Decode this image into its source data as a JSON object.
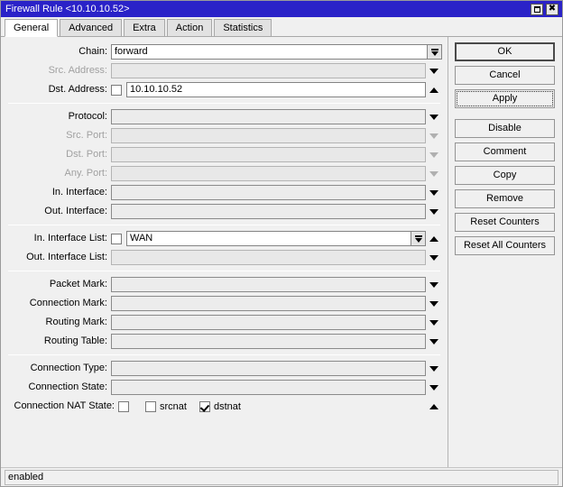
{
  "window": {
    "title": "Firewall Rule <10.10.10.52>",
    "restore_label": "restore-icon",
    "close_label": "✖"
  },
  "tabs": [
    {
      "label": "General",
      "active": true
    },
    {
      "label": "Advanced",
      "active": false
    },
    {
      "label": "Extra",
      "active": false
    },
    {
      "label": "Action",
      "active": false
    },
    {
      "label": "Statistics",
      "active": false
    }
  ],
  "form": {
    "group1": [
      {
        "label": "Chain:",
        "value": "forward",
        "disabled": false,
        "checkbox": null,
        "control": "combo"
      },
      {
        "label": "Src. Address:",
        "value": "",
        "disabled": true,
        "checkbox": null,
        "control": "down"
      },
      {
        "label": "Dst. Address:",
        "value": "10.10.10.52",
        "disabled": false,
        "checkbox": false,
        "control": "up"
      }
    ],
    "group2": [
      {
        "label": "Protocol:",
        "value": "",
        "disabled": false,
        "checkbox": null,
        "control": "down"
      },
      {
        "label": "Src. Port:",
        "value": "",
        "disabled": true,
        "checkbox": null,
        "control": "down-dim"
      },
      {
        "label": "Dst. Port:",
        "value": "",
        "disabled": true,
        "checkbox": null,
        "control": "down-dim"
      },
      {
        "label": "Any. Port:",
        "value": "",
        "disabled": true,
        "checkbox": null,
        "control": "down-dim"
      },
      {
        "label": "In. Interface:",
        "value": "",
        "disabled": false,
        "checkbox": null,
        "control": "down"
      },
      {
        "label": "Out. Interface:",
        "value": "",
        "disabled": false,
        "checkbox": null,
        "control": "down"
      }
    ],
    "group3": [
      {
        "label": "In. Interface List:",
        "value": "WAN",
        "disabled": false,
        "checkbox": false,
        "control": "combo-up"
      },
      {
        "label": "Out. Interface List:",
        "value": "",
        "disabled": true,
        "checkbox": null,
        "control": "down"
      }
    ],
    "group4": [
      {
        "label": "Packet Mark:",
        "value": "",
        "disabled": false,
        "checkbox": null,
        "control": "down"
      },
      {
        "label": "Connection Mark:",
        "value": "",
        "disabled": false,
        "checkbox": null,
        "control": "down"
      },
      {
        "label": "Routing Mark:",
        "value": "",
        "disabled": false,
        "checkbox": null,
        "control": "down"
      },
      {
        "label": "Routing Table:",
        "value": "",
        "disabled": false,
        "checkbox": null,
        "control": "down"
      }
    ],
    "group5": [
      {
        "label": "Connection Type:",
        "value": "",
        "disabled": false,
        "checkbox": null,
        "control": "down"
      },
      {
        "label": "Connection State:",
        "value": "",
        "disabled": false,
        "checkbox": null,
        "control": "down"
      }
    ],
    "nat_state": {
      "label": "Connection NAT State:",
      "options": [
        {
          "text": "",
          "checked": false
        },
        {
          "text": "srcnat",
          "checked": false
        },
        {
          "text": "dstnat",
          "checked": true
        }
      ],
      "control": "up"
    }
  },
  "buttons": [
    {
      "label": "OK",
      "style": "primary"
    },
    {
      "label": "Cancel",
      "style": "normal"
    },
    {
      "label": "Apply",
      "style": "focus"
    },
    {
      "label": "Disable",
      "style": "normal"
    },
    {
      "label": "Comment",
      "style": "normal"
    },
    {
      "label": "Copy",
      "style": "normal"
    },
    {
      "label": "Remove",
      "style": "normal"
    },
    {
      "label": "Reset Counters",
      "style": "normal"
    },
    {
      "label": "Reset All Counters",
      "style": "normal"
    }
  ],
  "status": {
    "text": "enabled"
  },
  "colors": {
    "titlebar": "#2a22c8",
    "face": "#f0f0f0",
    "field": "#ffffff",
    "disabled_field": "#e8e8e8"
  }
}
